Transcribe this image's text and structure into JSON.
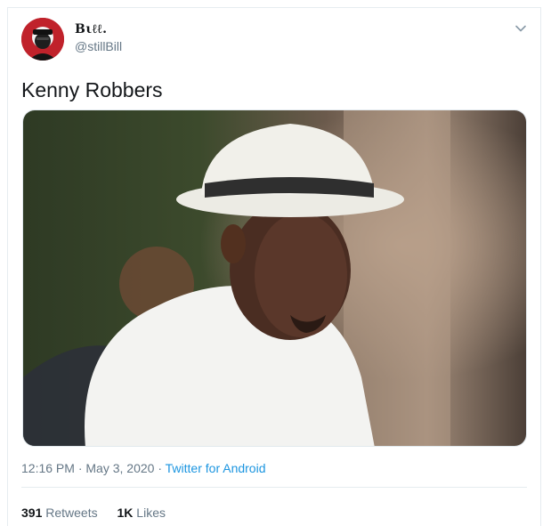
{
  "tweet": {
    "display_name": "Bιℓℓ.",
    "handle": "@stillBill",
    "text": "Kenny Robbers",
    "time": "12:16 PM",
    "date": "May 3, 2020",
    "source": "Twitter for Android",
    "retweets_count": "391",
    "retweets_label": "Retweets",
    "likes_count": "1K",
    "likes_label": "Likes"
  }
}
